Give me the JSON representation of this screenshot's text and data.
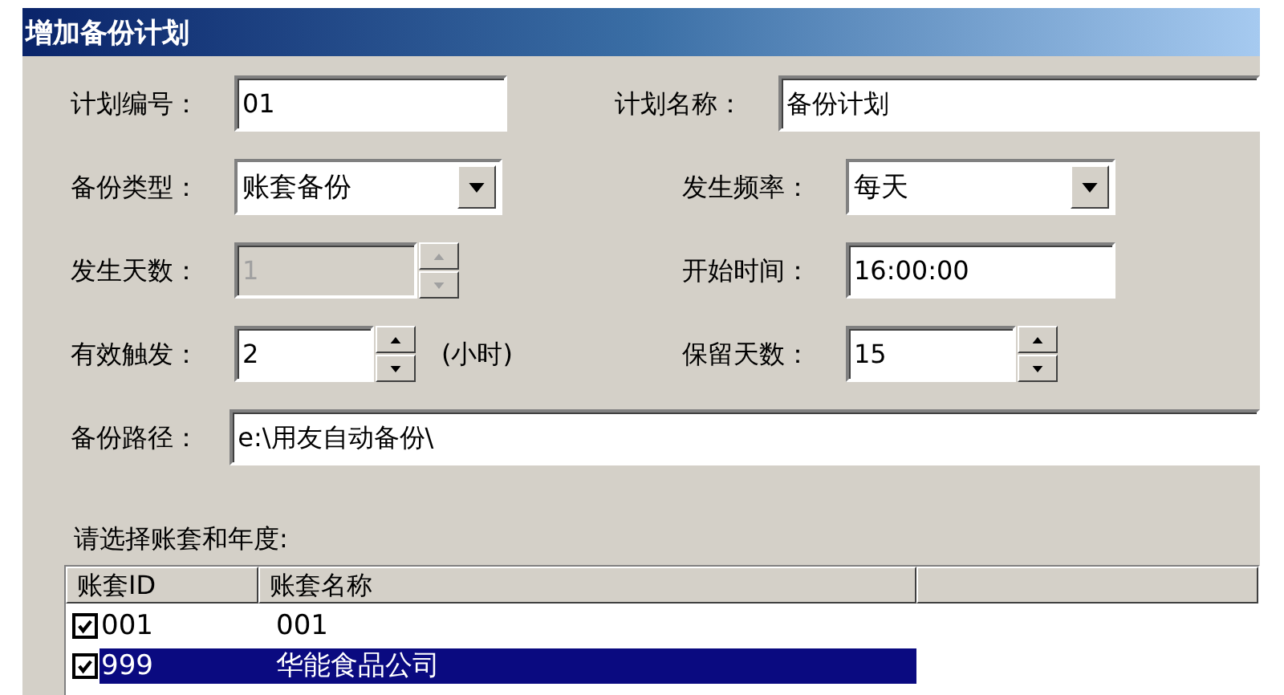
{
  "window": {
    "title": "增加备份计划"
  },
  "rows": [
    [
      {
        "label": "计划编号：",
        "kind": "text",
        "value": "01",
        "disabled": false
      },
      {
        "label": "计划名称：",
        "kind": "text",
        "value": "备份计划",
        "disabled": false
      }
    ],
    [
      {
        "label": "备份类型：",
        "kind": "combo",
        "value": "账套备份",
        "disabled": false
      },
      {
        "label": "发生频率：",
        "kind": "combo",
        "value": "每天",
        "disabled": false
      }
    ],
    [
      {
        "label": "发生天数：",
        "kind": "spin",
        "value": "1",
        "disabled": true
      },
      {
        "label": "开始时间：",
        "kind": "text",
        "value": "16:00:00",
        "disabled": false
      }
    ],
    [
      {
        "label": "有效触发：",
        "kind": "spin",
        "value": "2",
        "unit": "(小时)",
        "disabled": false
      },
      {
        "label": "保留天数：",
        "kind": "spin",
        "value": "15",
        "disabled": false
      }
    ],
    [
      {
        "label": "备份路径：",
        "kind": "text",
        "value": "e:\\用友自动备份\\",
        "disabled": false
      }
    ]
  ],
  "list_label": "请选择账套和年度:",
  "table": {
    "columns": [
      "账套ID",
      "账套名称"
    ],
    "rows": [
      {
        "checked": true,
        "selected": false,
        "cells": [
          "001",
          "001"
        ]
      },
      {
        "checked": true,
        "selected": true,
        "cells": [
          "999",
          "华能食品公司"
        ]
      }
    ]
  }
}
